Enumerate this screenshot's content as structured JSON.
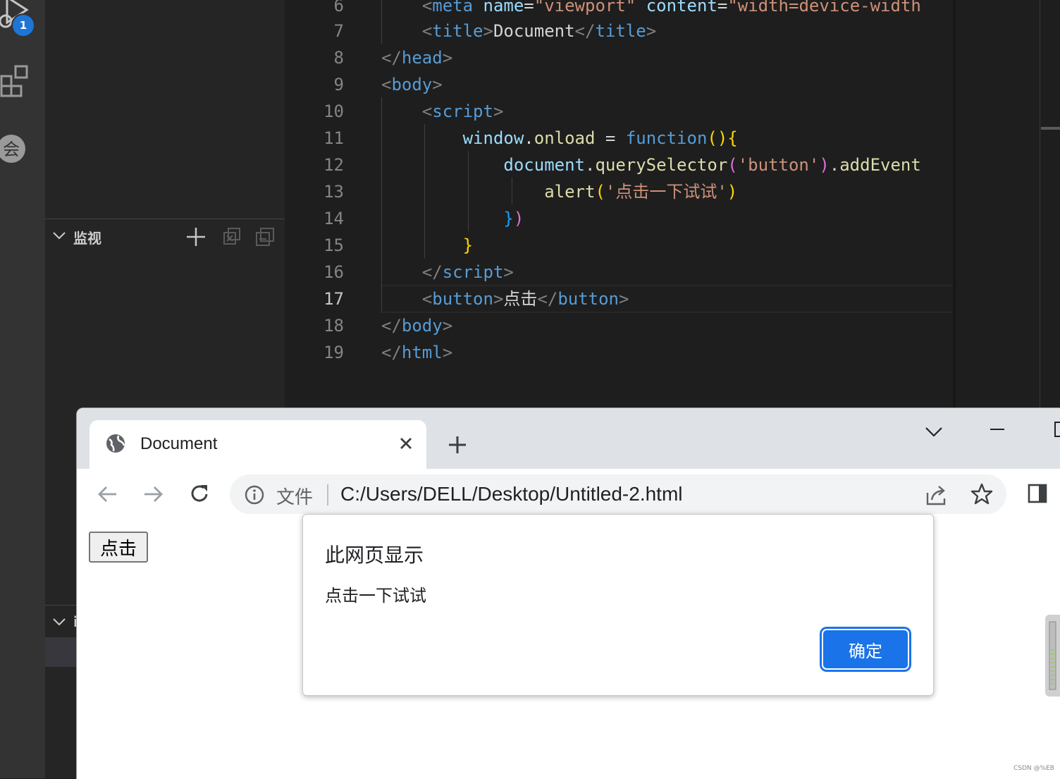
{
  "activity_bar": {
    "debug_badge": "1"
  },
  "sidebar": {
    "watch_title": "监视",
    "callstack_title_partial": "i"
  },
  "editor": {
    "lines": [
      {
        "num": "6"
      },
      {
        "num": "7"
      },
      {
        "num": "8"
      },
      {
        "num": "9"
      },
      {
        "num": "10"
      },
      {
        "num": "11"
      },
      {
        "num": "12"
      },
      {
        "num": "13"
      },
      {
        "num": "14"
      },
      {
        "num": "15"
      },
      {
        "num": "16"
      },
      {
        "num": "17"
      },
      {
        "num": "18"
      },
      {
        "num": "19"
      }
    ],
    "code": {
      "l6_meta": "meta",
      "l6_name": "name",
      "l6_value": "\"viewport\"",
      "l6_content": "content",
      "l6_content_value": "\"width=device-width",
      "l7_text": "Document",
      "l12_selector": "'button'",
      "l13_message": "'点击一下试试'",
      "l17_text": "点击"
    }
  },
  "browser": {
    "tab_title": "Document",
    "omnibox_label": "文件",
    "url": "C:/Users/DELL/Desktop/Untitled-2.html",
    "page_button_label": "点击"
  },
  "dialog": {
    "title": "此网页显示",
    "message": "点击一下试试",
    "ok_label": "确定"
  },
  "watermark": "CSDN @%EB"
}
